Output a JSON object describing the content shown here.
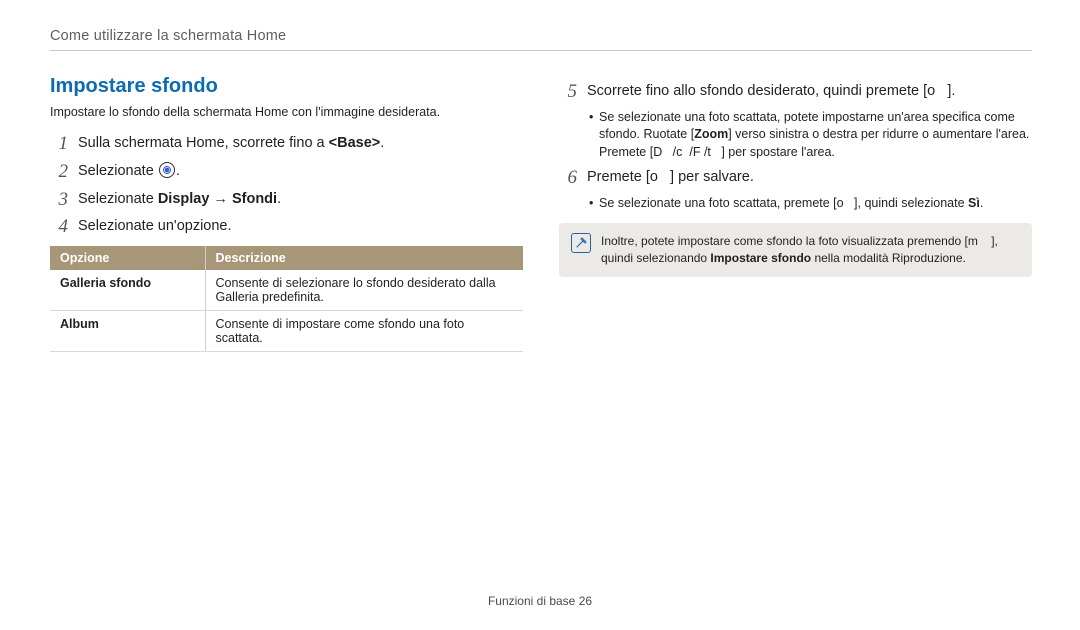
{
  "breadcrumb": "Come utilizzare la schermata Home",
  "left": {
    "heading": "Impostare sfondo",
    "intro": "Impostare lo sfondo della schermata Home con l'immagine desiderata.",
    "steps": {
      "s1_num": "1",
      "s1_a": "Sulla schermata Home, scorrete fino a ",
      "s1_b": "<Base>",
      "s1_c": ".",
      "s2_num": "2",
      "s2_a": "Selezionate ",
      "s2_b": ".",
      "s3_num": "3",
      "s3_a": "Selezionate ",
      "s3_b": "Display",
      "s3_c": " → ",
      "s3_d": "Sfondi",
      "s3_e": ".",
      "s4_num": "4",
      "s4": "Selezionate un'opzione."
    },
    "table": {
      "h1": "Opzione",
      "h2": "Descrizione",
      "r1_name": "Galleria sfondo",
      "r1_desc": "Consente di selezionare lo sfondo desiderato dalla Galleria predefinita.",
      "r2_name": "Album",
      "r2_desc": "Consente di impostare come sfondo una foto scattata."
    }
  },
  "right": {
    "s5_num": "5",
    "s5_a": "Scorrete fino allo sfondo desiderato, quindi premete [",
    "s5_b": "o",
    "s5_c": "].",
    "s5_sub1_a": "Se selezionate una foto scattata, potete impostarne un'area specifica come sfondo. Ruotate [",
    "s5_sub1_b": "Zoom",
    "s5_sub1_c": "] verso sinistra o destra per ridurre o aumentare l'area. Premete [",
    "s5_sub1_d": "D",
    "s5_sub1_e": "/",
    "s5_sub1_f": "c",
    "s5_sub1_g": "/",
    "s5_sub1_h": "F",
    "s5_sub1_i": "/",
    "s5_sub1_j": "t",
    "s5_sub1_k": "] per spostare l'area.",
    "s6_num": "6",
    "s6_a": "Premete [",
    "s6_b": "o",
    "s6_c": "] per salvare.",
    "s6_sub1_a": "Se selezionate una foto scattata, premete [",
    "s6_sub1_b": "o",
    "s6_sub1_c": "], quindi selezionate ",
    "s6_sub1_d": "Sì",
    "s6_sub1_e": ".",
    "note_a": "Inoltre, potete impostare come sfondo la foto visualizzata premendo [",
    "note_b": "m",
    "note_c": "], quindi selezionando ",
    "note_d": "Impostare sfondo",
    "note_e": " nella modalità Riproduzione."
  },
  "footer_a": "Funzioni di base  ",
  "footer_b": "26"
}
